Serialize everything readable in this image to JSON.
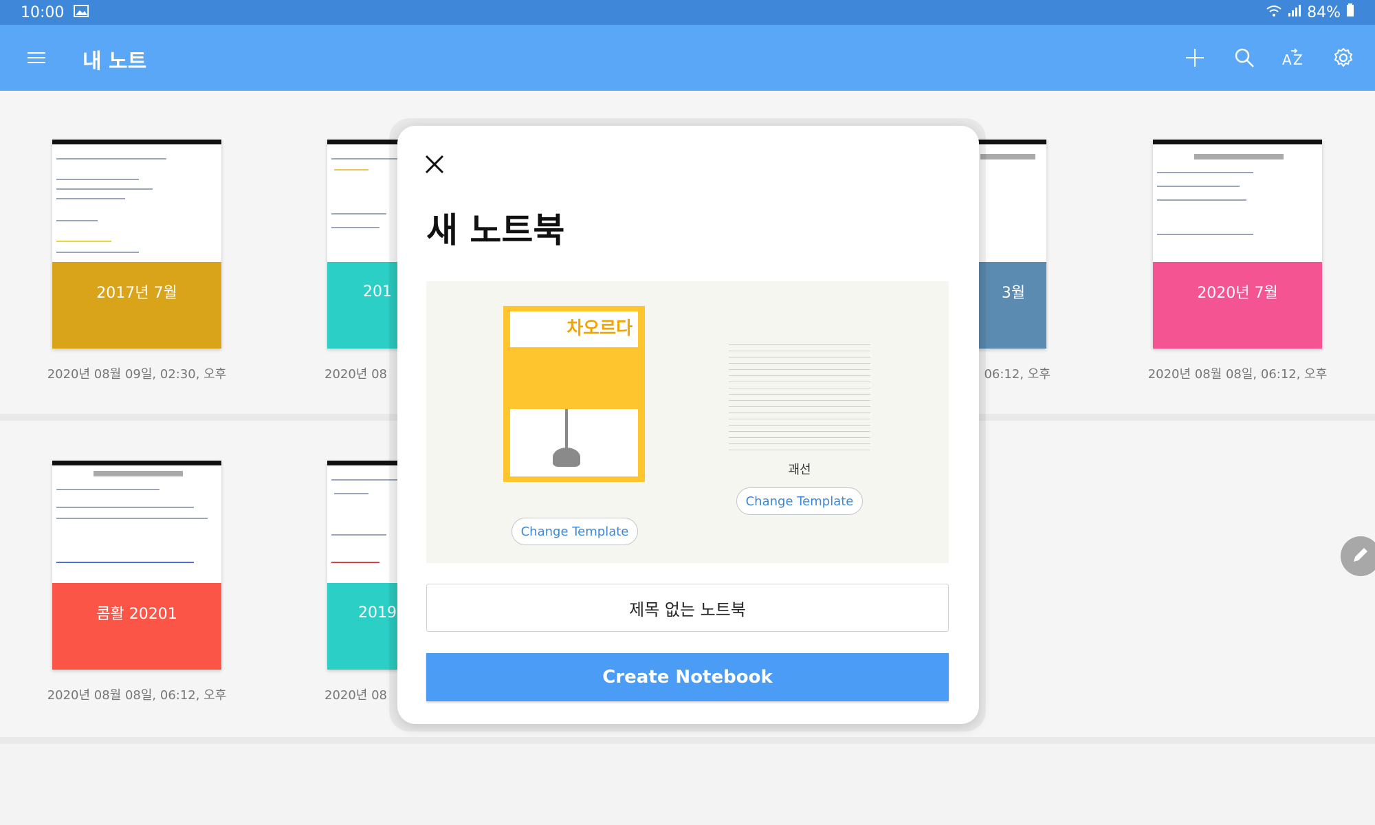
{
  "status_bar": {
    "time": "10:00",
    "battery": "84%"
  },
  "app_bar": {
    "title": "내 노트"
  },
  "notebooks": [
    {
      "cover_label": "2017년 7월",
      "date": "2020년 08월 09일, 02:30, 오후",
      "color": "#d9a31a"
    },
    {
      "cover_label": "201",
      "date": "2020년 08",
      "color": "#2ccfc6"
    },
    {
      "cover_label": "3월",
      "date": ", 06:12, 오후",
      "color": "#5b8bb0"
    },
    {
      "cover_label": "2020년 7월",
      "date": "2020년 08월 08일, 06:12, 오후",
      "color": "#f55493"
    },
    {
      "cover_label": "콤활 20201",
      "date": "2020년 08월 08일, 06:12, 오후",
      "color": "#fb5547"
    },
    {
      "cover_label": "2019",
      "date": "2020년 08",
      "color": "#2ccfc6"
    }
  ],
  "dialog": {
    "title": "새 노트북",
    "cover_brand": "차오르다",
    "paper_name": "괘선",
    "change_template_label": "Change Template",
    "notebook_name": "제목 없는 노트북",
    "create_label": "Create Notebook"
  },
  "colors": {
    "status_bar": "#3f87d9",
    "app_bar": "#5aa7f7",
    "accent": "#4a9cf4",
    "cover_yellow": "#ffc52e"
  },
  "icons": [
    "menu-icon",
    "plus-icon",
    "search-icon",
    "sort-az-icon",
    "gear-icon",
    "close-icon",
    "pencil-icon",
    "wifi-icon",
    "signal-icon",
    "battery-icon",
    "image-icon"
  ]
}
